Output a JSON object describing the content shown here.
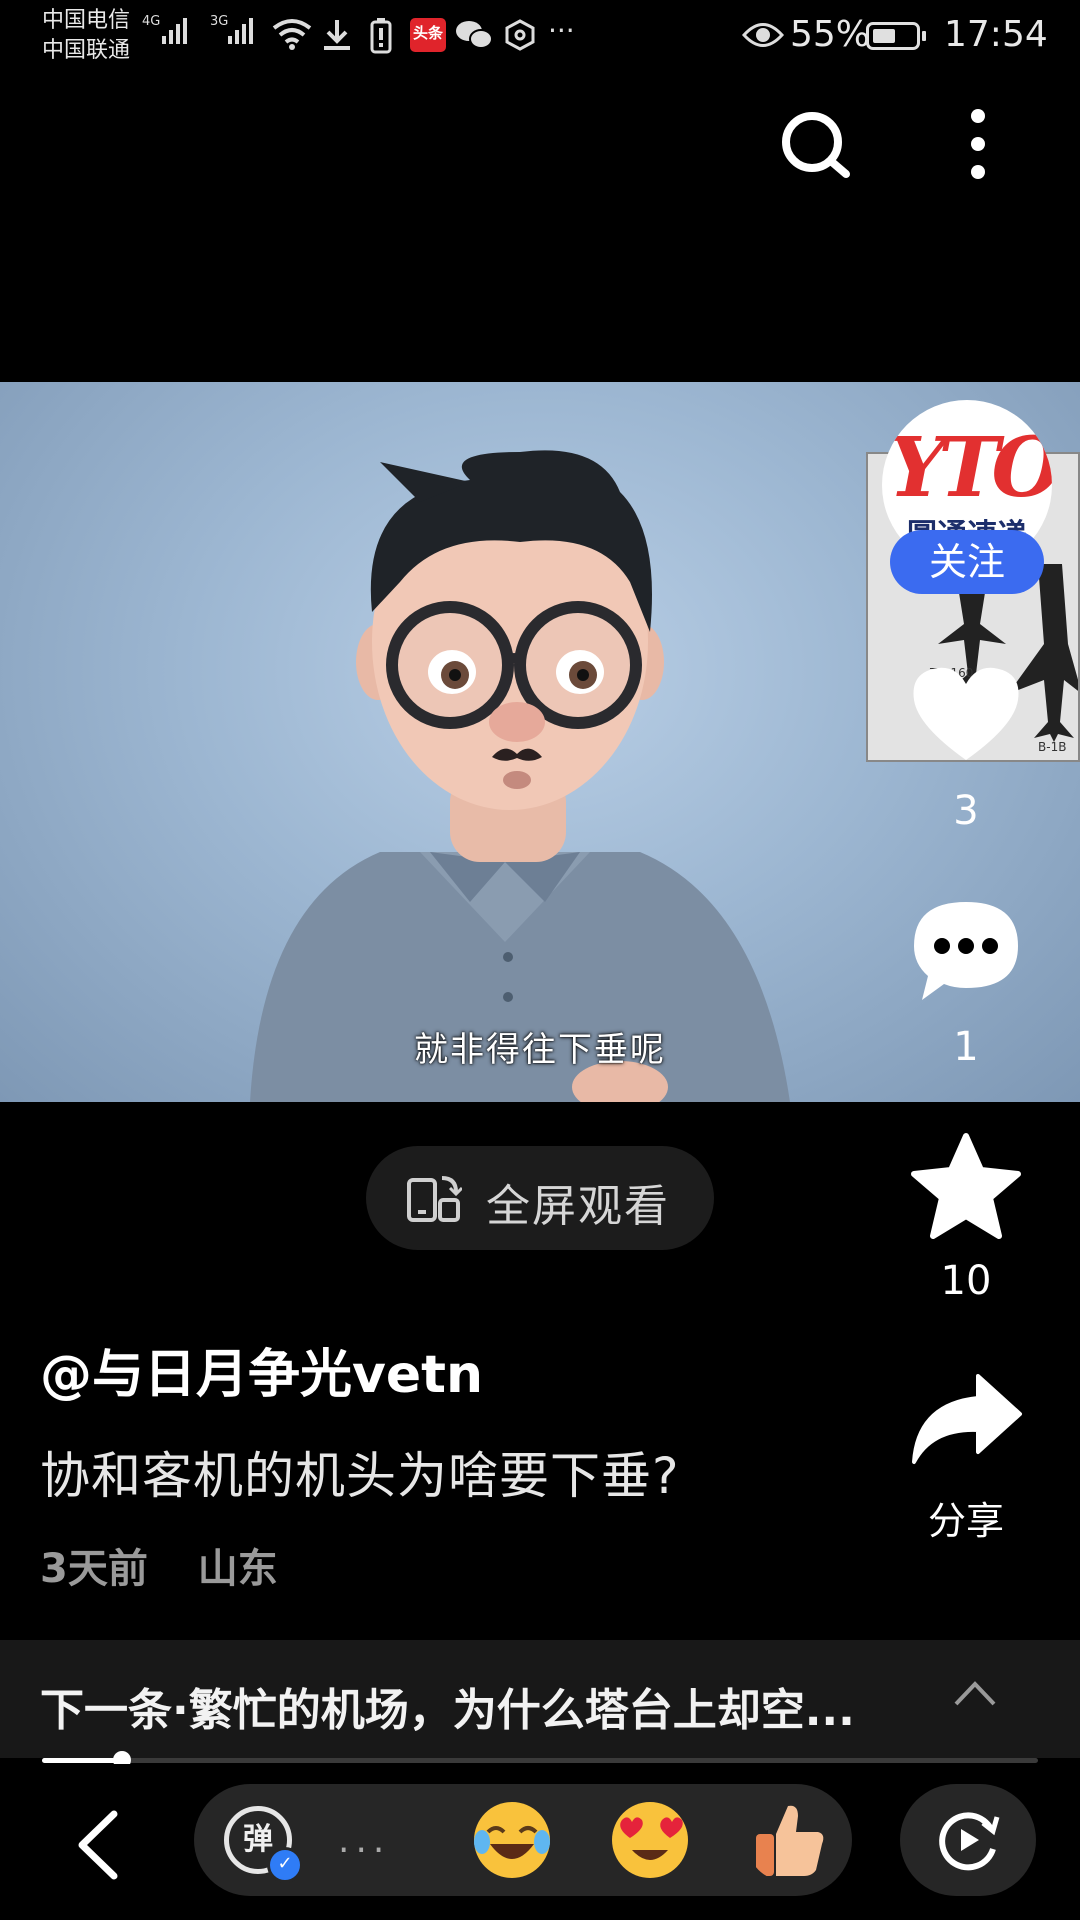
{
  "status_bar": {
    "carrier_1": "中国电信",
    "carrier_2": "中国联通",
    "network_1": "4G",
    "network_2": "3G",
    "toutiao_badge": "头条",
    "overflow": "···",
    "battery_percent": "55%",
    "battery_level": 0.55,
    "time": "17:54",
    "icons": [
      "signal-icon",
      "wifi-icon",
      "download-icon",
      "battery-alert-icon",
      "toutiao-app-icon",
      "wechat-icon",
      "hexagon-icon",
      "eye-icon",
      "battery-icon"
    ]
  },
  "top_bar": {
    "icons": [
      "search-icon",
      "more-vertical-icon"
    ]
  },
  "video": {
    "subtitle": "就非得往下垂呢",
    "poster_labels": [
      "TU-160",
      "B-1B"
    ]
  },
  "side_rail": {
    "avatar_logo_text": "YTO",
    "avatar_subtext": "圆通速递",
    "follow_label": "关注",
    "like_count": "3",
    "comment_count": "1",
    "favorite_count": "10",
    "share_label": "分享"
  },
  "fullscreen_button": {
    "label": "全屏观看",
    "icon": "rotate-screen-icon"
  },
  "post": {
    "author": "@与日月争光vetn",
    "title": "协和客机的机头为啥要下垂?",
    "time_ago": "3天前",
    "location": "山东"
  },
  "next_bar": {
    "label": "下一条·繁忙的机场，为什么塔台上却空...",
    "icon": "chevron-up-icon"
  },
  "playback": {
    "progress": 0.08
  },
  "bottom_bar": {
    "danmaku_label": "弹",
    "dots": "...",
    "emojis": [
      "laughing-crying-emoji",
      "heart-eyes-emoji",
      "thumbs-up-emoji"
    ],
    "icons": [
      "back-arrow-icon",
      "replay-icon"
    ]
  },
  "colors": {
    "follow_blue": "#3b6bf0",
    "background": "#000000",
    "video_bg": "#9db7d2"
  }
}
